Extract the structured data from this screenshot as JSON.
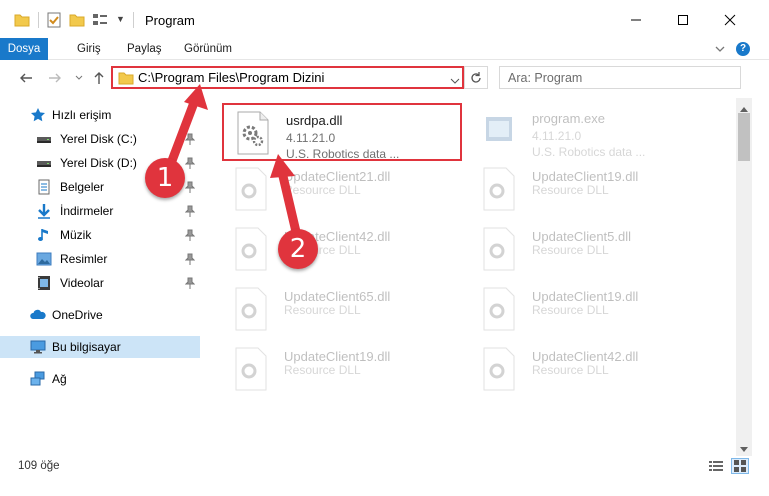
{
  "window": {
    "title": "Program",
    "controls": {
      "minimize": "minimize-icon",
      "maximize": "maximize-icon",
      "close": "close-icon"
    }
  },
  "quick_access_toolbar": [
    "folder-icon",
    "properties-check-icon",
    "new-folder-icon",
    "view-icon"
  ],
  "ribbon": {
    "tabs": [
      {
        "label": "Dosya",
        "active": true
      },
      {
        "label": "Giriş"
      },
      {
        "label": "Paylaş"
      },
      {
        "label": "Görünüm"
      }
    ],
    "help": "?"
  },
  "address_bar": {
    "path": "C:\\Program Files\\Program Dizini",
    "search_placeholder": "Ara: Program"
  },
  "sidebar": {
    "quick_access": {
      "label": "Hızlı erişim"
    },
    "items": [
      {
        "label": "Yerel Disk (C:)",
        "icon": "drive-icon",
        "pinned": true
      },
      {
        "label": "Yerel Disk (D:)",
        "icon": "drive-icon",
        "pinned": true
      },
      {
        "label": "Belgeler",
        "icon": "documents-icon",
        "pinned": true
      },
      {
        "label": "İndirmeler",
        "icon": "downloads-icon",
        "pinned": true
      },
      {
        "label": "Müzik",
        "icon": "music-icon",
        "pinned": true
      },
      {
        "label": "Resimler",
        "icon": "pictures-icon",
        "pinned": true
      },
      {
        "label": "Videolar",
        "icon": "videos-icon",
        "pinned": true
      }
    ],
    "onedrive": {
      "label": "OneDrive"
    },
    "this_pc": {
      "label": "Bu bilgisayar",
      "selected": true
    },
    "network": {
      "label": "Ağ"
    }
  },
  "files": [
    {
      "name": "usrdpa.dll",
      "version": "4.11.21.0",
      "description": "U.S. Robotics data ...",
      "highlighted": true
    },
    {
      "name": "program.exe",
      "version": "4.11.21.0",
      "description": "U.S. Robotics data ...",
      "faded": true
    },
    {
      "name": "UpdateClient21.dll",
      "version": "",
      "description": "Resource DLL",
      "faded": true
    },
    {
      "name": "UpdateClient19.dll",
      "version": "",
      "description": "Resource DLL",
      "faded": true
    },
    {
      "name": "UpdateClient42.dll",
      "version": "",
      "description": "Resource DLL",
      "faded": true
    },
    {
      "name": "UpdateClient5.dll",
      "version": "",
      "description": "Resource DLL",
      "faded": true
    },
    {
      "name": "UpdateClient65.dll",
      "version": "",
      "description": "Resource DLL",
      "faded": true
    },
    {
      "name": "UpdateClient19.dll",
      "version": "",
      "description": "Resource DLL",
      "faded": true
    },
    {
      "name": "UpdateClient19.dll",
      "version": "",
      "description": "Resource DLL",
      "faded": true
    },
    {
      "name": "UpdateClient42.dll",
      "version": "",
      "description": "Resource DLL",
      "faded": true
    }
  ],
  "status": {
    "count": "109 öğe"
  },
  "annotations": [
    {
      "label": "1"
    },
    {
      "label": "2"
    }
  ],
  "colors": {
    "accent": "#1979ca",
    "highlight_red": "#e0343d",
    "selection": "#cce4f7",
    "folder": "#f2c94c"
  }
}
